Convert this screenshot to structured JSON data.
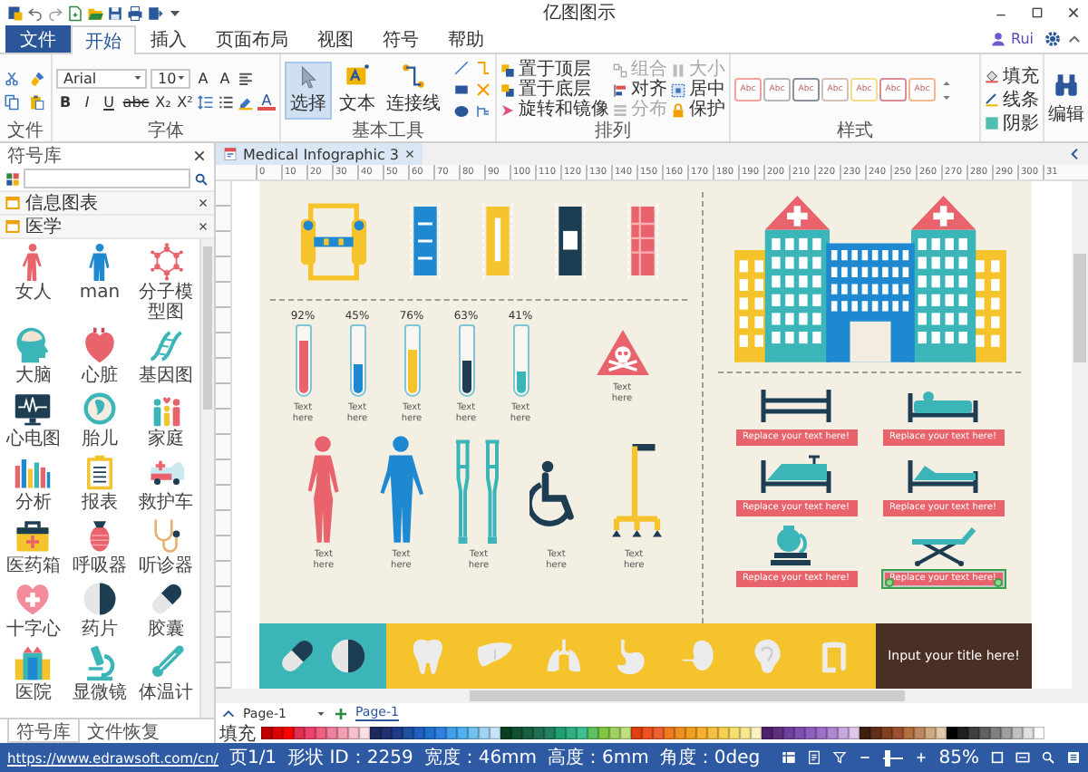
{
  "window": {
    "title": "亿图图示",
    "user": "Rui"
  },
  "menu": {
    "file": "文件",
    "tabs": [
      {
        "label": "开始",
        "selected": true
      },
      {
        "label": "插入",
        "selected": false
      },
      {
        "label": "页面布局",
        "selected": false
      },
      {
        "label": "视图",
        "selected": false
      },
      {
        "label": "符号",
        "selected": false
      },
      {
        "label": "帮助",
        "selected": false
      }
    ]
  },
  "ribbon": {
    "clipboard": {
      "label": "文件"
    },
    "font": {
      "label": "字体",
      "family": "Arial",
      "size": "10",
      "size_steps": [
        "A",
        "A"
      ],
      "format_buttons": [
        "B",
        "I",
        "U",
        "abc",
        "X₂",
        "X²"
      ],
      "font_color": "A"
    },
    "tools": {
      "label": "基本工具",
      "items": [
        {
          "label": "选择",
          "selected": true
        },
        {
          "label": "文本",
          "selected": false
        },
        {
          "label": "连接线",
          "selected": false
        }
      ]
    },
    "arrange": {
      "label": "排列",
      "items": [
        {
          "label": "置于顶层",
          "disabled": false
        },
        {
          "label": "置于底层",
          "disabled": false
        },
        {
          "label": "旋转和镜像",
          "disabled": false
        },
        {
          "label": "组合",
          "disabled": true
        },
        {
          "label": "对齐",
          "disabled": false
        },
        {
          "label": "分布",
          "disabled": true
        },
        {
          "label": "大小",
          "disabled": true
        },
        {
          "label": "居中",
          "disabled": false
        },
        {
          "label": "保护",
          "disabled": false
        }
      ]
    },
    "styles": {
      "label": "样式",
      "items": [
        {
          "text": "Abc",
          "color": "#f2a49c"
        },
        {
          "text": "Abc",
          "color": "#b8b8b8"
        },
        {
          "text": "Abc",
          "color": "#8a8f98"
        },
        {
          "text": "Abc",
          "color": "#d4c0b8"
        },
        {
          "text": "Abc",
          "color": "#f3dc8c"
        },
        {
          "text": "Abc",
          "color": "#d88c98"
        },
        {
          "text": "Abc",
          "color": "#f4b890"
        }
      ]
    },
    "format": [
      {
        "label": "填充"
      },
      {
        "label": "线条"
      },
      {
        "label": "阴影"
      }
    ],
    "edit": {
      "label": "编辑"
    }
  },
  "library": {
    "title": "符号库",
    "categories": [
      {
        "label": "信息图表"
      },
      {
        "label": "医学"
      }
    ],
    "symbols": [
      {
        "label": "女人"
      },
      {
        "label": "man"
      },
      {
        "label": "分子模型图"
      },
      {
        "label": "大脑"
      },
      {
        "label": "心脏"
      },
      {
        "label": "基因图"
      },
      {
        "label": "心电图"
      },
      {
        "label": "胎儿"
      },
      {
        "label": "家庭"
      },
      {
        "label": "分析"
      },
      {
        "label": "报表"
      },
      {
        "label": "救护车"
      },
      {
        "label": "医药箱"
      },
      {
        "label": "呼吸器"
      },
      {
        "label": "听诊器"
      },
      {
        "label": "十字心"
      },
      {
        "label": "药片"
      },
      {
        "label": "胶囊"
      },
      {
        "label": "医院"
      },
      {
        "label": "显微镜"
      },
      {
        "label": "体温计"
      }
    ],
    "bottom_tabs": [
      {
        "label": "符号库",
        "selected": true
      },
      {
        "label": "文件恢复",
        "selected": false
      }
    ]
  },
  "document": {
    "tab": "Medical Infographic 3",
    "ruler": [
      "0",
      "10",
      "20",
      "30",
      "40",
      "50",
      "60",
      "70",
      "80",
      "90",
      "100",
      "110",
      "120",
      "130",
      "140",
      "150",
      "160",
      "170",
      "180",
      "190",
      "200",
      "210",
      "220",
      "230",
      "240",
      "250",
      "260",
      "270",
      "280",
      "290",
      "300",
      "31"
    ]
  },
  "infographic": {
    "tubes": [
      {
        "percent": "92%",
        "level": 0.8,
        "color": "#e8636b",
        "caption": "Text here"
      },
      {
        "percent": "45%",
        "level": 0.44,
        "color": "#1e88d0",
        "caption": "Text here"
      },
      {
        "percent": "76%",
        "level": 0.68,
        "color": "#f5c32c",
        "caption": "Text here"
      },
      {
        "percent": "63%",
        "level": 0.5,
        "color": "#1d3d52",
        "caption": "Text here"
      },
      {
        "percent": "41%",
        "level": 0.32,
        "color": "#3bb5b8",
        "caption": "Text here"
      }
    ],
    "warning": {
      "caption": "Text here"
    },
    "figures": [
      {
        "caption": "Text here"
      },
      {
        "caption": "Text here"
      },
      {
        "caption": "Text here"
      },
      {
        "caption": "Text here"
      },
      {
        "caption": "Text here"
      }
    ],
    "labels": [
      {
        "text": "Replace your text here!",
        "selected": false
      },
      {
        "text": "Replace your text here!",
        "selected": false
      },
      {
        "text": "Replace your text here!",
        "selected": false
      },
      {
        "text": "Replace your text here!",
        "selected": false
      },
      {
        "text": "Replace your text here!",
        "selected": false
      },
      {
        "text": "Replace your text here!",
        "selected": true
      }
    ],
    "title": "Input your title here!"
  },
  "pages": {
    "dropdown": "Page-1",
    "tabs": [
      {
        "label": "Page-1",
        "selected": true
      }
    ]
  },
  "palette": {
    "label": "填充",
    "swatches": [
      {
        "color": "#c00000"
      },
      {
        "color": "#e00000"
      },
      {
        "color": "#ff0000"
      },
      {
        "color": "#e03050"
      },
      {
        "color": "#f04070"
      },
      {
        "color": "#f06080"
      },
      {
        "color": "#f080a0"
      },
      {
        "color": "#f4a0b4"
      },
      {
        "color": "#f8c0cc"
      },
      {
        "color": "#fce0e6"
      },
      {
        "color": "#1f2a5c"
      },
      {
        "color": "#203070"
      },
      {
        "color": "#1f3c88"
      },
      {
        "color": "#2050a0"
      },
      {
        "color": "#2060c0"
      },
      {
        "color": "#2070d0"
      },
      {
        "color": "#3080e0"
      },
      {
        "color": "#40a0e8"
      },
      {
        "color": "#50b0f0"
      },
      {
        "color": "#70c0f0"
      },
      {
        "color": "#a0d4f4"
      },
      {
        "color": "#c8e4f8"
      },
      {
        "color": "#0a4020"
      },
      {
        "color": "#105030"
      },
      {
        "color": "#186040"
      },
      {
        "color": "#207050"
      },
      {
        "color": "#208060"
      },
      {
        "color": "#20a070"
      },
      {
        "color": "#30b080"
      },
      {
        "color": "#40c090"
      },
      {
        "color": "#60c060"
      },
      {
        "color": "#80c840"
      },
      {
        "color": "#a0d060"
      },
      {
        "color": "#c0e080"
      },
      {
        "color": "#e04010"
      },
      {
        "color": "#f05020"
      },
      {
        "color": "#f06030"
      },
      {
        "color": "#f07a20"
      },
      {
        "color": "#f09020"
      },
      {
        "color": "#f0a020"
      },
      {
        "color": "#f8b030"
      },
      {
        "color": "#f8c040"
      },
      {
        "color": "#f8d050"
      },
      {
        "color": "#f8e070"
      },
      {
        "color": "#fae890"
      },
      {
        "color": "#fcf4c0"
      },
      {
        "color": "#502070"
      },
      {
        "color": "#603080"
      },
      {
        "color": "#7040a0"
      },
      {
        "color": "#8050b0"
      },
      {
        "color": "#9060c0"
      },
      {
        "color": "#a070c8"
      },
      {
        "color": "#b088d0"
      },
      {
        "color": "#c8a8e0"
      },
      {
        "color": "#e0c8ec"
      },
      {
        "color": "#402010"
      },
      {
        "color": "#603018"
      },
      {
        "color": "#804020"
      },
      {
        "color": "#a05030"
      },
      {
        "color": "#b07040"
      },
      {
        "color": "#c08860"
      },
      {
        "color": "#d0a880"
      },
      {
        "color": "#e0c8a8"
      },
      {
        "color": "#000000"
      },
      {
        "color": "#202020"
      },
      {
        "color": "#404040"
      },
      {
        "color": "#606060"
      },
      {
        "color": "#808080"
      },
      {
        "color": "#a0a0a0"
      },
      {
        "color": "#c0c0c0"
      },
      {
        "color": "#e0e0e0"
      },
      {
        "color": "#ffffff"
      }
    ]
  },
  "status": {
    "link": "https://www.edrawsoft.com/cn/",
    "page": "页1/1",
    "shape_id": "形状 ID：2259",
    "width": "宽度：46mm",
    "height": "高度：6mm",
    "angle": "角度：0deg",
    "zoom": "85%",
    "zoom_slider": {
      "level": 0.2
    }
  }
}
